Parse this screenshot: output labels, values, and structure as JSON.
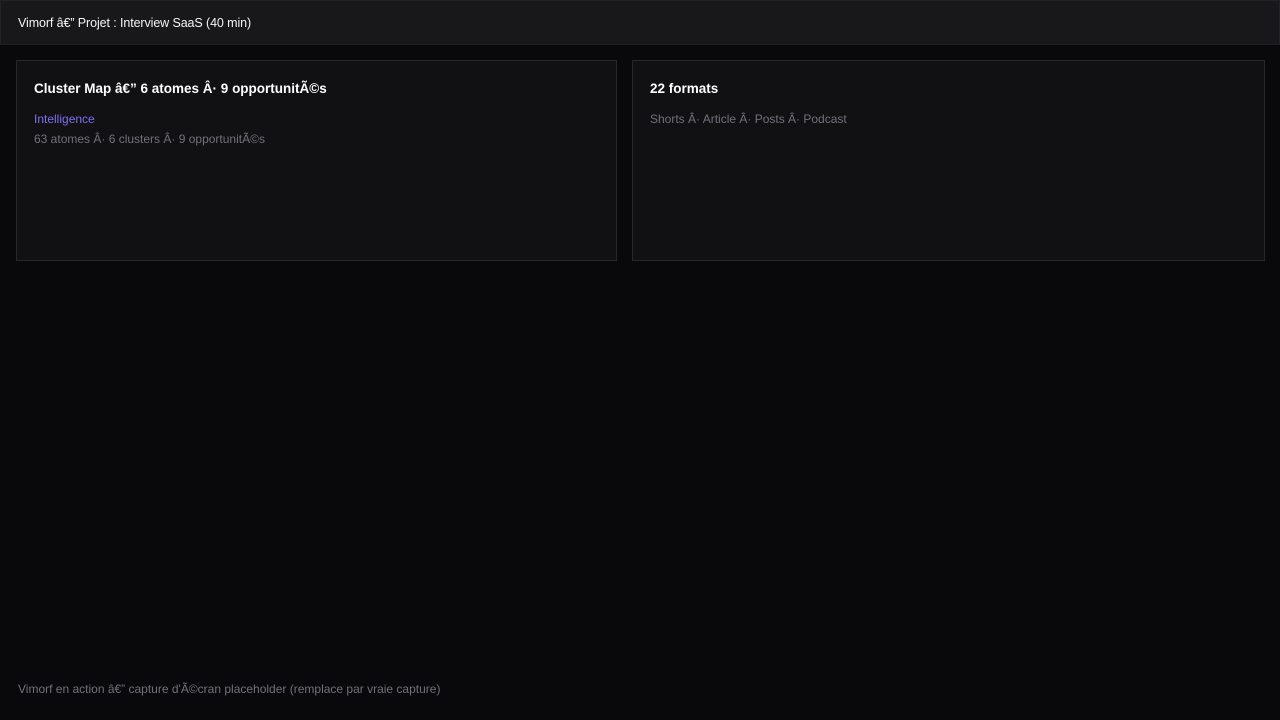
{
  "window": {
    "title": "Vimorf â€” Projet : Interview SaaS (40 min)"
  },
  "cards": [
    {
      "title": "Cluster Map â€” 6 atomes Â· 9 opportunitÃ©s",
      "tag": "Intelligence",
      "meta": "63 atomes Â· 6 clusters Â· 9 opportunitÃ©s"
    },
    {
      "title": "22 formats",
      "meta": "Shorts Â· Article Â· Posts Â· Podcast"
    }
  ],
  "footer": {
    "caption": "Vimorf en action â€” capture d'Ã©cran placeholder (remplace par vraie capture)"
  },
  "colors": {
    "background": "#09090b",
    "titlebar": "#18181b",
    "card": "#111114",
    "border": "#27272a",
    "accent": "#7c6ff2",
    "muted": "#71717a"
  }
}
